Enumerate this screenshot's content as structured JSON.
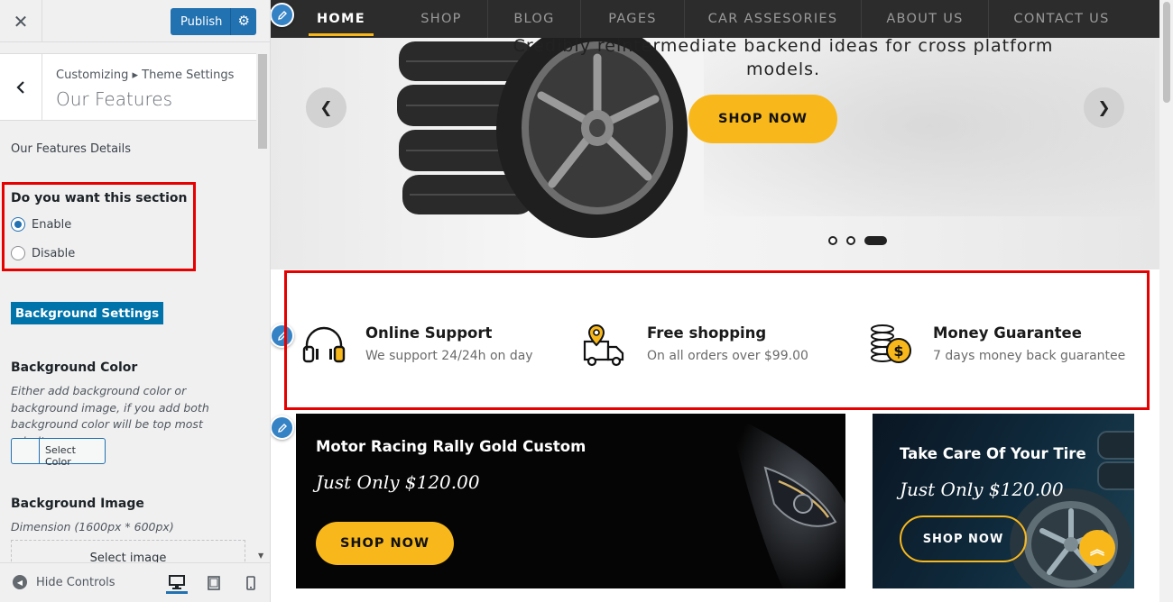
{
  "sidebar": {
    "close_icon": "close-icon",
    "publish_label": "Publish",
    "breadcrumb": "Customizing ▸ Theme Settings",
    "section_title": "Our Features",
    "details_heading": "Our Features Details",
    "section_toggle": {
      "label": "Do you want this section",
      "options": [
        {
          "label": "Enable",
          "checked": true
        },
        {
          "label": "Disable",
          "checked": false
        }
      ]
    },
    "background_settings_label": "Background Settings",
    "background_color": {
      "label": "Background Color",
      "description": "Either add background color or background image, if you add both background color will be top most priority",
      "button_label": "Select Color"
    },
    "background_image": {
      "label": "Background Image",
      "dimension": "Dimension (1600px * 600px)",
      "button_label": "Select image"
    },
    "footer": {
      "hide_controls_label": "Hide Controls",
      "devices": [
        "desktop",
        "tablet",
        "mobile"
      ]
    }
  },
  "preview": {
    "nav": [
      {
        "label": "HOME",
        "active": true
      },
      {
        "label": "SHOP",
        "active": false
      },
      {
        "label": "BLOG",
        "active": false
      },
      {
        "label": "PAGES",
        "active": false
      },
      {
        "label": "CAR ASSESORIES",
        "active": false
      },
      {
        "label": "ABOUT US",
        "active": false
      },
      {
        "label": "CONTACT US",
        "active": false
      }
    ],
    "hero": {
      "text_line_1": "Credibly reintermediate backend ideas for cross platform",
      "text_line_2": "models.",
      "shop_now": "SHOP NOW",
      "dots_count": 3,
      "active_dot": 3
    },
    "features": [
      {
        "icon": "headphones-icon",
        "title": "Online Support",
        "subtitle": "We support 24/24h on day"
      },
      {
        "icon": "delivery-truck-icon",
        "title": "Free shopping",
        "subtitle": "On all orders over $99.00"
      },
      {
        "icon": "coins-icon",
        "title": "Money Guarantee",
        "subtitle": "7 days money back guarantee"
      }
    ],
    "promos": [
      {
        "title": "Motor Racing Rally Gold Custom",
        "price": "Just Only $120.00",
        "button": "SHOP NOW"
      },
      {
        "title": "Take Care Of Your Tire",
        "price": "Just Only $120.00",
        "button": "SHOP NOW"
      }
    ]
  },
  "colors": {
    "accent": "#f8b81c",
    "wp_blue": "#2271b1",
    "highlight_red": "#e60000",
    "nav_bg": "#2c2c2c"
  }
}
